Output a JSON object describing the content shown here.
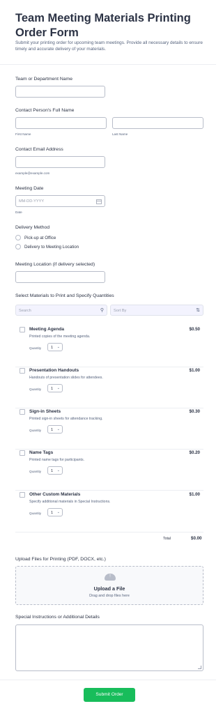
{
  "header": {
    "title": "Team Meeting Materials Printing Order Form",
    "subtitle": "Submit your printing order for upcoming team meetings. Provide all necessary details to ensure timely and accurate delivery of your materials."
  },
  "fields": {
    "team_label": "Team or Department Name",
    "contact_label": "Contact Person's Full Name",
    "first_name_sublabel": "First Name",
    "last_name_sublabel": "Last Name",
    "email_label": "Contact Email Address",
    "email_sublabel": "example@example.com",
    "date_label": "Meeting Date",
    "date_placeholder": "MM-DD-YYYY",
    "date_sublabel": "Date",
    "delivery_label": "Delivery Method",
    "delivery_options": [
      "Pick-up at Office",
      "Delivery to Meeting Location"
    ],
    "location_label": "Meeting Location (if delivery selected)"
  },
  "materials": {
    "label": "Select Materials to Print and Specify Quantities",
    "search_placeholder": "Search",
    "sort_placeholder": "Sort By",
    "quantity_label": "Quantity",
    "products": [
      {
        "name": "Meeting Agenda",
        "desc": "Printed copies of the meeting agenda.",
        "price": "$0.50",
        "qty": "1"
      },
      {
        "name": "Presentation Handouts",
        "desc": "Handouts of presentation slides for attendees.",
        "price": "$1.00",
        "qty": "1"
      },
      {
        "name": "Sign-in Sheets",
        "desc": "Printed sign-in sheets for attendance tracking.",
        "price": "$0.30",
        "qty": "1"
      },
      {
        "name": "Name Tags",
        "desc": "Printed name tags for participants.",
        "price": "$0.20",
        "qty": "1"
      },
      {
        "name": "Other Custom Materials",
        "desc": "Specify additional materials in Special Instructions.",
        "price": "$1.00",
        "qty": "1"
      }
    ],
    "total_label": "Total",
    "total_value": "$0.00"
  },
  "upload": {
    "label": "Upload Files for Printing (PDF, DOCX, etc.)",
    "title": "Upload a File",
    "subtitle": "Drag and drop files here"
  },
  "instructions": {
    "label": "Special Instructions or Additional Details"
  },
  "submit_label": "Submit Order",
  "colors": {
    "submit": "#18bd5b",
    "text": "#2c3345",
    "muted": "#57647e"
  },
  "icons": {
    "search": "search-icon",
    "sort": "sort-icon",
    "calendar": "calendar-icon",
    "upload": "cloud-upload-icon"
  }
}
